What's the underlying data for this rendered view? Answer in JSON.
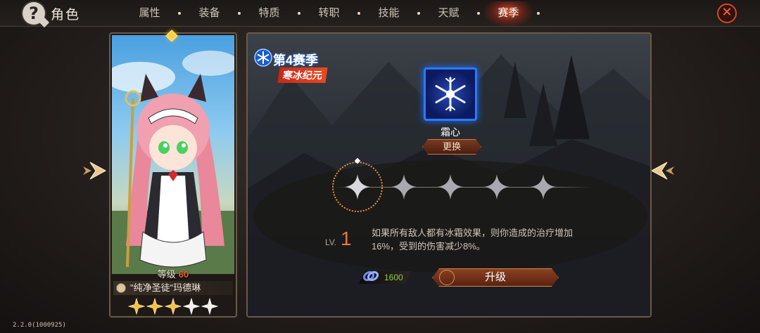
{
  "header": {
    "title": "角色",
    "tabs": [
      {
        "label": "属性",
        "active": false
      },
      {
        "label": "装备",
        "active": false
      },
      {
        "label": "特质",
        "active": false
      },
      {
        "label": "转职",
        "active": false
      },
      {
        "label": "技能",
        "active": false
      },
      {
        "label": "天赋",
        "active": false
      },
      {
        "label": "赛季",
        "active": true
      }
    ],
    "close_icon": "close-x-icon",
    "help_icon": "question-mark-icon"
  },
  "character": {
    "level_label": "等级",
    "level_value": "60",
    "name": "\"纯净圣徒\"玛德琳",
    "stars_total": 5,
    "stars_filled": 3
  },
  "season": {
    "number_label": "第4赛季",
    "name": "寒冰纪元",
    "badge_icon": "snowflake-icon",
    "talent": {
      "name": "霜心",
      "icon": "snowflake-crystal-icon",
      "change_label": "更换"
    },
    "progress_nodes": 5,
    "current_node": 1,
    "level_label": "LV.",
    "level_value": "1",
    "effect_description": "如果所有敌人都有冰霜效果，则你造成的治疗增加16%，受到的伤害减少8%。",
    "cost_value": "1600",
    "upgrade_label": "升级"
  },
  "footer": {
    "version": "2.2.0(1000925)"
  },
  "colors": {
    "accent": "#e87838",
    "active_tab_glow": "#ff5a28",
    "talent_border": "#2a7aff",
    "cost_text": "#8ad048"
  }
}
